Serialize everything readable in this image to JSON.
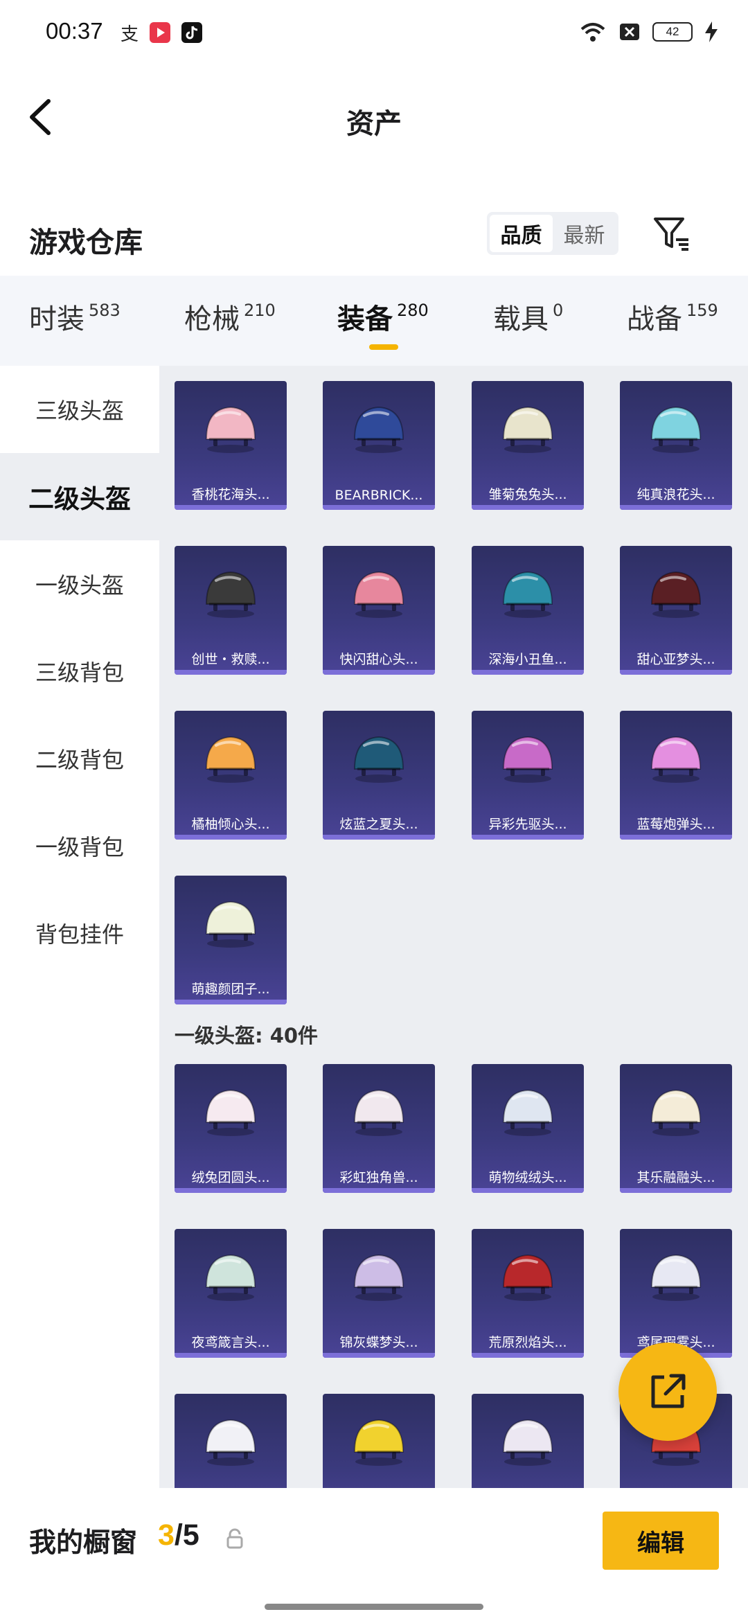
{
  "status_bar": {
    "time": "00:37",
    "battery": "42"
  },
  "header": {
    "title": "资产"
  },
  "section": {
    "title": "游戏仓库",
    "sort_quality": "品质",
    "sort_latest": "最新"
  },
  "tabs": [
    {
      "label": "时装",
      "count": "583"
    },
    {
      "label": "枪械",
      "count": "210"
    },
    {
      "label": "装备",
      "count": "280"
    },
    {
      "label": "载具",
      "count": "0"
    },
    {
      "label": "战备",
      "count": "159"
    }
  ],
  "sidebar": [
    {
      "label": "三级头盔"
    },
    {
      "label": "二级头盔"
    },
    {
      "label": "一级头盔"
    },
    {
      "label": "三级背包"
    },
    {
      "label": "二级背包"
    },
    {
      "label": "一级背包"
    },
    {
      "label": "背包挂件"
    }
  ],
  "items_level2": [
    {
      "name": "香桃花海头...",
      "color": "#f2b7c4"
    },
    {
      "name": "BEARBRICK...",
      "color": "#2f4a9a"
    },
    {
      "name": "雏菊兔兔头...",
      "color": "#e8e4cc"
    },
    {
      "name": "纯真浪花头...",
      "color": "#7fd3e0"
    },
    {
      "name": "创世・救赎...",
      "color": "#3a3a3a"
    },
    {
      "name": "快闪甜心头...",
      "color": "#e7879d"
    },
    {
      "name": "深海小丑鱼...",
      "color": "#2c8fa8"
    },
    {
      "name": "甜心亚梦头...",
      "color": "#5a1f24"
    },
    {
      "name": "橘柚倾心头...",
      "color": "#f5a94a"
    },
    {
      "name": "炫蓝之夏头...",
      "color": "#1f5a78"
    },
    {
      "name": "异彩先驱头...",
      "color": "#c86ac8"
    },
    {
      "name": "蓝莓炮弹头...",
      "color": "#e48fe0"
    },
    {
      "name": "萌趣颜团子...",
      "color": "#eef1da"
    }
  ],
  "level1_header": "一级头盔: 40件",
  "items_level1": [
    {
      "name": "绒兔团圆头...",
      "color": "#f6eaf0"
    },
    {
      "name": "彩虹独角兽...",
      "color": "#f1e8ee"
    },
    {
      "name": "萌物绒绒头...",
      "color": "#dfe6f1"
    },
    {
      "name": "其乐融融头...",
      "color": "#f4ecd8"
    },
    {
      "name": "夜鸢箴言头...",
      "color": "#cfe4dc"
    },
    {
      "name": "锦灰蝶梦头...",
      "color": "#cdbde6"
    },
    {
      "name": "荒原烈焰头...",
      "color": "#b8282b"
    },
    {
      "name": "鸢尾瑕雾头...",
      "color": "#e7e8f3"
    },
    {
      "name": "",
      "color": "#f1f1f6"
    },
    {
      "name": "",
      "color": "#f1d22e"
    },
    {
      "name": "",
      "color": "#ece7f2"
    },
    {
      "name": "",
      "color": "#d8413a"
    }
  ],
  "bottom": {
    "label": "我的橱窗",
    "current": "3",
    "total": "/5",
    "edit": "编辑"
  },
  "colors": {
    "accent": "#f6b714",
    "card_bg": "#3b3a7e"
  }
}
